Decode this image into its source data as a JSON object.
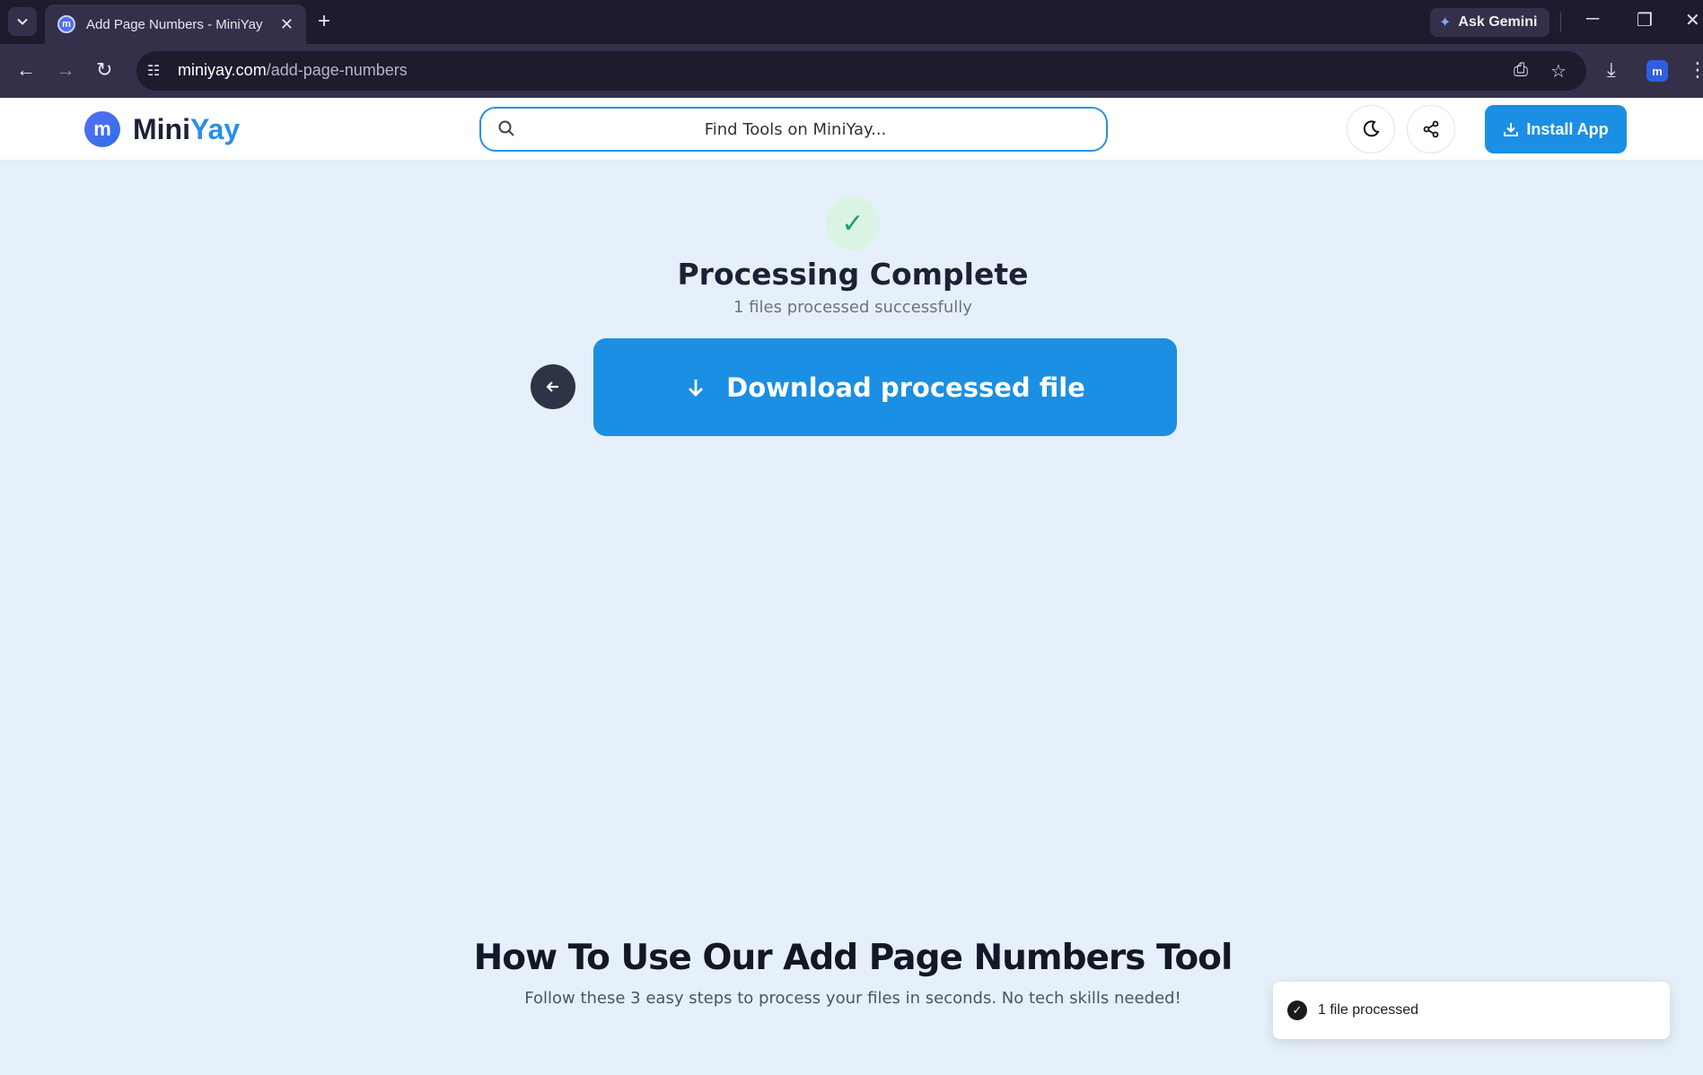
{
  "browser": {
    "tab_title": "Add Page Numbers - MiniYay",
    "tab_favicon": "m",
    "gemini_label": "Ask Gemini",
    "url_host": "miniyay.com",
    "url_path": "/add-page-numbers"
  },
  "header": {
    "logo_letter": "m",
    "logo_part1": "Mini",
    "logo_part2": "Yay",
    "search_placeholder": "Find Tools on MiniYay...",
    "install_label": "Install App"
  },
  "result": {
    "check_glyph": "✓",
    "title": "Processing Complete",
    "subtitle": "1 files processed successfully",
    "download_label": "Download processed file"
  },
  "howto": {
    "title": "How To Use Our Add Page Numbers Tool",
    "subtitle": "Follow these 3 easy steps to process your files in seconds. No tech skills needed!"
  },
  "toast": {
    "message": "1 file processed"
  },
  "colors": {
    "brand_blue": "#1a8fe3",
    "page_bg": "#e6f0fa",
    "success_green": "#22a355"
  }
}
